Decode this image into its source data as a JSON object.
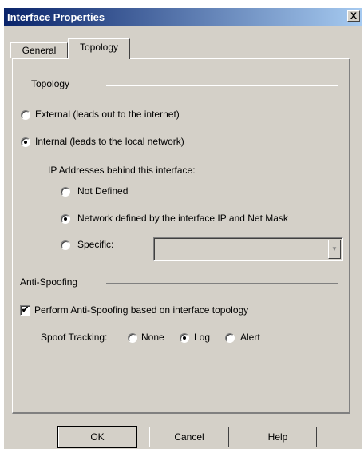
{
  "window": {
    "title": "Interface Properties",
    "close_label": "X"
  },
  "tabs": [
    {
      "label": "General"
    },
    {
      "label": "Topology"
    }
  ],
  "topology": {
    "section_label": "Topology",
    "external_label": "External (leads out to the internet)",
    "internal_label": "Internal (leads to the local network)",
    "selected": "internal",
    "ip_behind_label": "IP Addresses behind this interface:",
    "options": {
      "not_defined": "Not Defined",
      "network_defined": "Network defined by the interface IP and Net Mask",
      "specific": "Specific:"
    },
    "ip_selected": "network_defined",
    "specific_value": ""
  },
  "anti_spoofing": {
    "section_label": "Anti-Spoofing",
    "perform_label": "Perform Anti-Spoofing based on interface topology",
    "perform_checked": true,
    "check_mark": "✔",
    "spoof_tracking_label": "Spoof Tracking:",
    "tracking_options": {
      "none": "None",
      "log": "Log",
      "alert": "Alert"
    },
    "tracking_selected": "log"
  },
  "buttons": {
    "ok": "OK",
    "cancel": "Cancel",
    "help": "Help"
  },
  "colors": {
    "dialog_bg": "#d4d0c8",
    "title_start": "#0a246a",
    "title_end": "#a6caf0"
  }
}
